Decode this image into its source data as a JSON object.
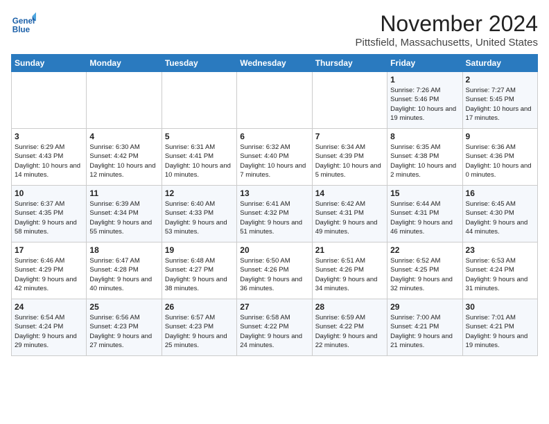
{
  "logo": {
    "line1": "General",
    "line2": "Blue"
  },
  "title": "November 2024",
  "location": "Pittsfield, Massachusetts, United States",
  "days_of_week": [
    "Sunday",
    "Monday",
    "Tuesday",
    "Wednesday",
    "Thursday",
    "Friday",
    "Saturday"
  ],
  "weeks": [
    [
      {
        "day": "",
        "info": ""
      },
      {
        "day": "",
        "info": ""
      },
      {
        "day": "",
        "info": ""
      },
      {
        "day": "",
        "info": ""
      },
      {
        "day": "",
        "info": ""
      },
      {
        "day": "1",
        "info": "Sunrise: 7:26 AM\nSunset: 5:46 PM\nDaylight: 10 hours and 19 minutes."
      },
      {
        "day": "2",
        "info": "Sunrise: 7:27 AM\nSunset: 5:45 PM\nDaylight: 10 hours and 17 minutes."
      }
    ],
    [
      {
        "day": "3",
        "info": "Sunrise: 6:29 AM\nSunset: 4:43 PM\nDaylight: 10 hours and 14 minutes."
      },
      {
        "day": "4",
        "info": "Sunrise: 6:30 AM\nSunset: 4:42 PM\nDaylight: 10 hours and 12 minutes."
      },
      {
        "day": "5",
        "info": "Sunrise: 6:31 AM\nSunset: 4:41 PM\nDaylight: 10 hours and 10 minutes."
      },
      {
        "day": "6",
        "info": "Sunrise: 6:32 AM\nSunset: 4:40 PM\nDaylight: 10 hours and 7 minutes."
      },
      {
        "day": "7",
        "info": "Sunrise: 6:34 AM\nSunset: 4:39 PM\nDaylight: 10 hours and 5 minutes."
      },
      {
        "day": "8",
        "info": "Sunrise: 6:35 AM\nSunset: 4:38 PM\nDaylight: 10 hours and 2 minutes."
      },
      {
        "day": "9",
        "info": "Sunrise: 6:36 AM\nSunset: 4:36 PM\nDaylight: 10 hours and 0 minutes."
      }
    ],
    [
      {
        "day": "10",
        "info": "Sunrise: 6:37 AM\nSunset: 4:35 PM\nDaylight: 9 hours and 58 minutes."
      },
      {
        "day": "11",
        "info": "Sunrise: 6:39 AM\nSunset: 4:34 PM\nDaylight: 9 hours and 55 minutes."
      },
      {
        "day": "12",
        "info": "Sunrise: 6:40 AM\nSunset: 4:33 PM\nDaylight: 9 hours and 53 minutes."
      },
      {
        "day": "13",
        "info": "Sunrise: 6:41 AM\nSunset: 4:32 PM\nDaylight: 9 hours and 51 minutes."
      },
      {
        "day": "14",
        "info": "Sunrise: 6:42 AM\nSunset: 4:31 PM\nDaylight: 9 hours and 49 minutes."
      },
      {
        "day": "15",
        "info": "Sunrise: 6:44 AM\nSunset: 4:31 PM\nDaylight: 9 hours and 46 minutes."
      },
      {
        "day": "16",
        "info": "Sunrise: 6:45 AM\nSunset: 4:30 PM\nDaylight: 9 hours and 44 minutes."
      }
    ],
    [
      {
        "day": "17",
        "info": "Sunrise: 6:46 AM\nSunset: 4:29 PM\nDaylight: 9 hours and 42 minutes."
      },
      {
        "day": "18",
        "info": "Sunrise: 6:47 AM\nSunset: 4:28 PM\nDaylight: 9 hours and 40 minutes."
      },
      {
        "day": "19",
        "info": "Sunrise: 6:48 AM\nSunset: 4:27 PM\nDaylight: 9 hours and 38 minutes."
      },
      {
        "day": "20",
        "info": "Sunrise: 6:50 AM\nSunset: 4:26 PM\nDaylight: 9 hours and 36 minutes."
      },
      {
        "day": "21",
        "info": "Sunrise: 6:51 AM\nSunset: 4:26 PM\nDaylight: 9 hours and 34 minutes."
      },
      {
        "day": "22",
        "info": "Sunrise: 6:52 AM\nSunset: 4:25 PM\nDaylight: 9 hours and 32 minutes."
      },
      {
        "day": "23",
        "info": "Sunrise: 6:53 AM\nSunset: 4:24 PM\nDaylight: 9 hours and 31 minutes."
      }
    ],
    [
      {
        "day": "24",
        "info": "Sunrise: 6:54 AM\nSunset: 4:24 PM\nDaylight: 9 hours and 29 minutes."
      },
      {
        "day": "25",
        "info": "Sunrise: 6:56 AM\nSunset: 4:23 PM\nDaylight: 9 hours and 27 minutes."
      },
      {
        "day": "26",
        "info": "Sunrise: 6:57 AM\nSunset: 4:23 PM\nDaylight: 9 hours and 25 minutes."
      },
      {
        "day": "27",
        "info": "Sunrise: 6:58 AM\nSunset: 4:22 PM\nDaylight: 9 hours and 24 minutes."
      },
      {
        "day": "28",
        "info": "Sunrise: 6:59 AM\nSunset: 4:22 PM\nDaylight: 9 hours and 22 minutes."
      },
      {
        "day": "29",
        "info": "Sunrise: 7:00 AM\nSunset: 4:21 PM\nDaylight: 9 hours and 21 minutes."
      },
      {
        "day": "30",
        "info": "Sunrise: 7:01 AM\nSunset: 4:21 PM\nDaylight: 9 hours and 19 minutes."
      }
    ]
  ]
}
